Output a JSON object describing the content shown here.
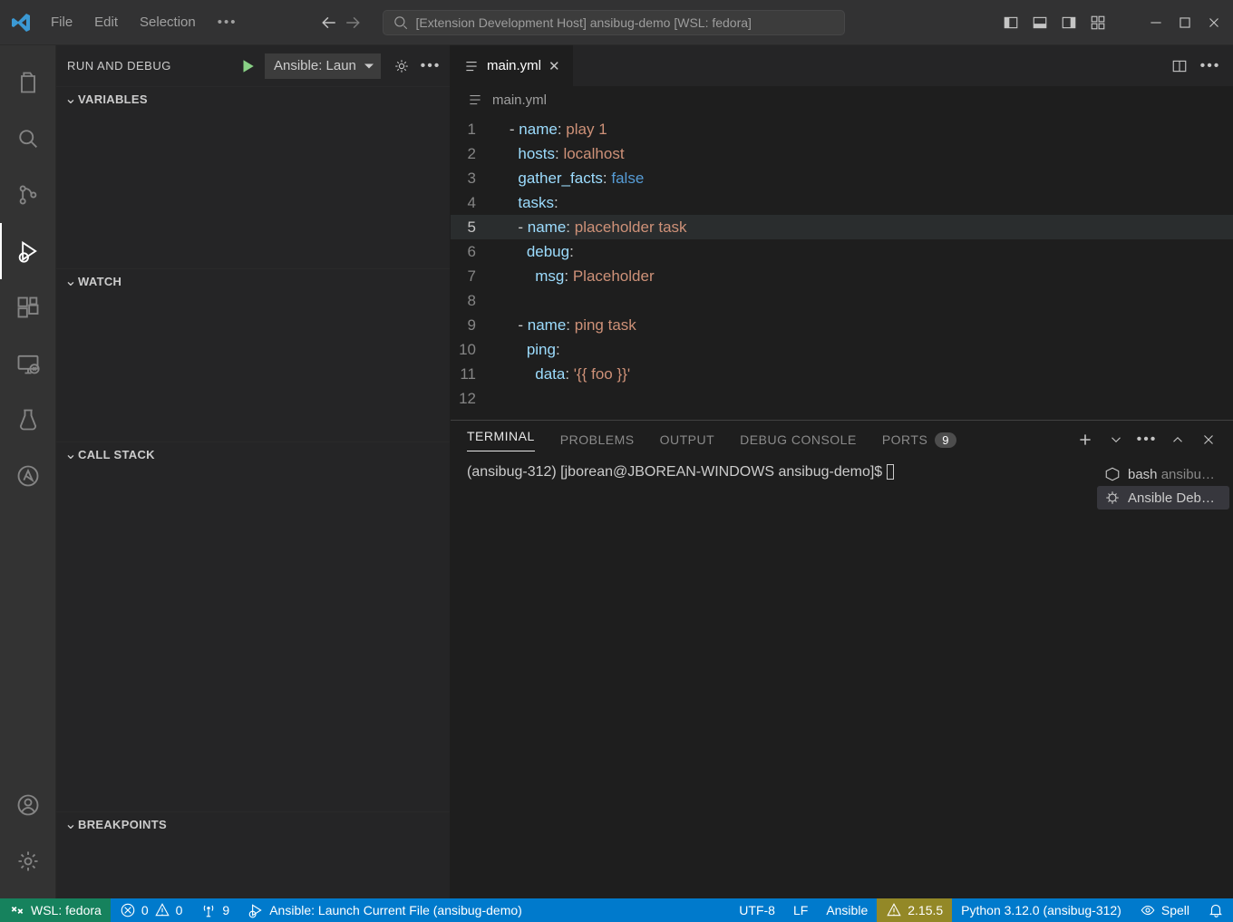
{
  "titlebar": {
    "menus": [
      "File",
      "Edit",
      "Selection"
    ],
    "search_label": "[Extension Development Host] ansibug-demo [WSL: fedora]"
  },
  "debug": {
    "panel_title": "RUN AND DEBUG",
    "config": "Ansible: Laun",
    "sections": {
      "variables": "VARIABLES",
      "watch": "WATCH",
      "callstack": "CALL STACK",
      "breakpoints": "BREAKPOINTS"
    }
  },
  "editor": {
    "tab_title": "main.yml",
    "breadcrumb": "main.yml",
    "lines": [
      {
        "n": "1",
        "seg": [
          [
            "- ",
            ""
          ],
          [
            "name",
            1
          ],
          [
            ": ",
            0
          ],
          [
            "play 1",
            2
          ]
        ]
      },
      {
        "n": "2",
        "seg": [
          [
            "  ",
            ""
          ],
          [
            "hosts",
            1
          ],
          [
            ": ",
            0
          ],
          [
            "localhost",
            2
          ]
        ]
      },
      {
        "n": "3",
        "seg": [
          [
            "  ",
            ""
          ],
          [
            "gather_facts",
            1
          ],
          [
            ": ",
            0
          ],
          [
            "false",
            3
          ]
        ]
      },
      {
        "n": "4",
        "seg": [
          [
            "  ",
            ""
          ],
          [
            "tasks",
            1
          ],
          [
            ":",
            0
          ]
        ]
      },
      {
        "n": "5",
        "cur": true,
        "seg": [
          [
            "  - ",
            ""
          ],
          [
            "name",
            1
          ],
          [
            ": ",
            0
          ],
          [
            "placeholder task",
            2
          ]
        ]
      },
      {
        "n": "6",
        "seg": [
          [
            "    ",
            ""
          ],
          [
            "debug",
            1
          ],
          [
            ":",
            0
          ]
        ]
      },
      {
        "n": "7",
        "seg": [
          [
            "      ",
            ""
          ],
          [
            "msg",
            1
          ],
          [
            ": ",
            0
          ],
          [
            "Placeholder",
            2
          ]
        ]
      },
      {
        "n": "8",
        "seg": []
      },
      {
        "n": "9",
        "seg": [
          [
            "  - ",
            ""
          ],
          [
            "name",
            1
          ],
          [
            ": ",
            0
          ],
          [
            "ping task",
            2
          ]
        ]
      },
      {
        "n": "10",
        "seg": [
          [
            "    ",
            ""
          ],
          [
            "ping",
            1
          ],
          [
            ":",
            0
          ]
        ]
      },
      {
        "n": "11",
        "seg": [
          [
            "      ",
            ""
          ],
          [
            "data",
            1
          ],
          [
            ": ",
            0
          ],
          [
            "'{{ foo }}'",
            2
          ]
        ]
      },
      {
        "n": "12",
        "seg": []
      }
    ]
  },
  "panel": {
    "tabs": {
      "terminal": "TERMINAL",
      "problems": "PROBLEMS",
      "output": "OUTPUT",
      "debugconsole": "DEBUG CONSOLE",
      "ports": "PORTS"
    },
    "ports_badge": "9",
    "prompt": "(ansibug-312) [jborean@JBOREAN-WINDOWS ansibug-demo]$ ",
    "terms": [
      {
        "icon": "bash",
        "label": "bash",
        "sub": "ansibu…"
      },
      {
        "icon": "debug",
        "label": "Ansible Deb…"
      }
    ]
  },
  "status": {
    "remote": "WSL: fedora",
    "errors": "0",
    "warnings": "0",
    "ports": "9",
    "launch": "Ansible: Launch Current File (ansibug-demo)",
    "encoding": "UTF-8",
    "eol": "LF",
    "lang": "Ansible",
    "lint": "2.15.5",
    "python": "Python 3.12.0 (ansibug-312)",
    "spell": "Spell"
  }
}
